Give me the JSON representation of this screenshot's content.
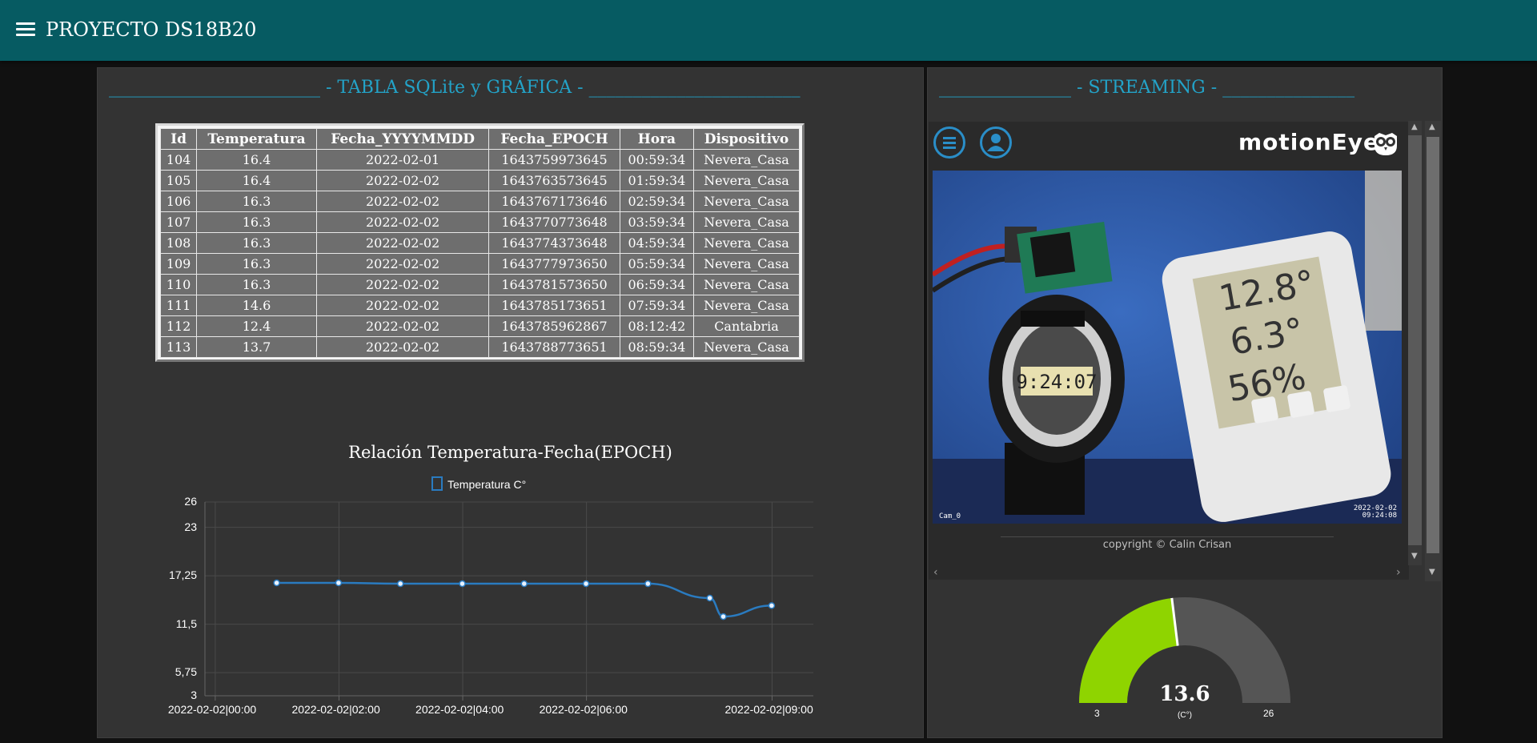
{
  "header": {
    "title": "PROYECTO DS18B20"
  },
  "left_panel": {
    "title": "________________________ - TABLA SQLite y GRÁFICA - ________________________",
    "table": {
      "columns": [
        "Id",
        "Temperatura",
        "Fecha_YYYYMMDD",
        "Fecha_EPOCH",
        "Hora",
        "Dispositivo"
      ],
      "rows": [
        [
          "104",
          "16.4",
          "2022-02-01",
          "1643759973645",
          "00:59:34",
          "Nevera_Casa"
        ],
        [
          "105",
          "16.4",
          "2022-02-02",
          "1643763573645",
          "01:59:34",
          "Nevera_Casa"
        ],
        [
          "106",
          "16.3",
          "2022-02-02",
          "1643767173646",
          "02:59:34",
          "Nevera_Casa"
        ],
        [
          "107",
          "16.3",
          "2022-02-02",
          "1643770773648",
          "03:59:34",
          "Nevera_Casa"
        ],
        [
          "108",
          "16.3",
          "2022-02-02",
          "1643774373648",
          "04:59:34",
          "Nevera_Casa"
        ],
        [
          "109",
          "16.3",
          "2022-02-02",
          "1643777973650",
          "05:59:34",
          "Nevera_Casa"
        ],
        [
          "110",
          "16.3",
          "2022-02-02",
          "1643781573650",
          "06:59:34",
          "Nevera_Casa"
        ],
        [
          "111",
          "14.6",
          "2022-02-02",
          "1643785173651",
          "07:59:34",
          "Nevera_Casa"
        ],
        [
          "112",
          "12.4",
          "2022-02-02",
          "1643785962867",
          "08:12:42",
          "Cantabria"
        ],
        [
          "113",
          "13.7",
          "2022-02-02",
          "1643788773651",
          "08:59:34",
          "Nevera_Casa"
        ]
      ]
    }
  },
  "chart_data": {
    "type": "line",
    "title": "Relación Temperatura-Fecha(EPOCH)",
    "legend": "top-center",
    "grid": true,
    "series": [
      {
        "name": "Temperatura C°",
        "color": "#2a7bc0",
        "x": [
          "2022-02-02 00:59:34",
          "2022-02-02 01:59:34",
          "2022-02-02 02:59:34",
          "2022-02-02 03:59:34",
          "2022-02-02 04:59:34",
          "2022-02-02 05:59:34",
          "2022-02-02 06:59:34",
          "2022-02-02 07:59:34",
          "2022-02-02 08:12:42",
          "2022-02-02 08:59:34"
        ],
        "values": [
          16.4,
          16.4,
          16.3,
          16.3,
          16.3,
          16.3,
          16.3,
          14.6,
          12.4,
          13.7
        ]
      }
    ],
    "xlim": [
      "2022-02-01 23:50",
      "2022-02-02 09:40"
    ],
    "ylim": [
      3,
      26
    ],
    "yticks": [
      "26",
      "23",
      "17,25",
      "11,5",
      "5,75",
      "3"
    ],
    "xticks": [
      "2022-02-02|00:00",
      "2022-02-02|02:00",
      "2022-02-02|04:00",
      "2022-02-02|06:00",
      "2022-02-02|09:00"
    ]
  },
  "right_panel": {
    "title": "_______________ - STREAMING - _______________",
    "stream": {
      "logo": "motionEye",
      "menu_icon": "hamburger-circle-icon",
      "user_icon": "user-circle-icon",
      "camera_name": "Cam_0",
      "overlay_time": "2022-02-02\n09:24:08",
      "copyright": "copyright © Calin Crisan"
    },
    "gauge": {
      "value": "13.6",
      "unit": "(C°)",
      "min": "3",
      "max": "26",
      "value_num": 13.6,
      "min_num": 3,
      "max_num": 26,
      "fill_color": "#8fd400",
      "track_color": "#555555"
    }
  }
}
